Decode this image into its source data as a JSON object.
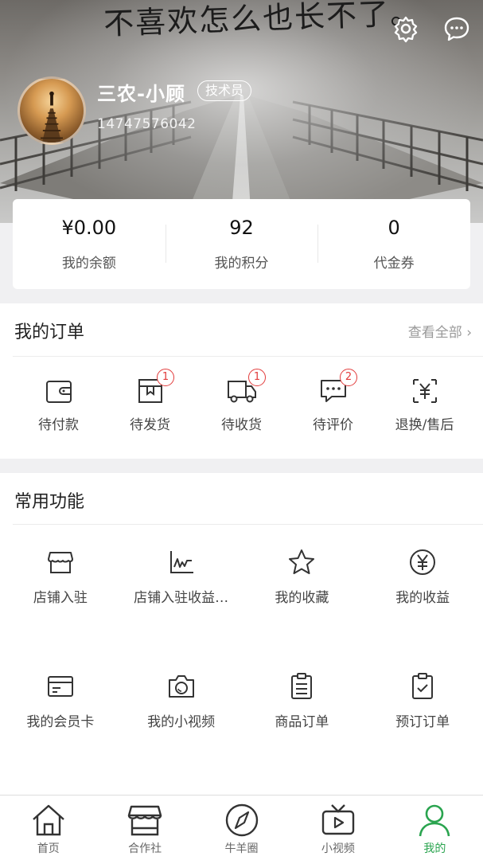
{
  "header": {
    "scribble_text": "不喜欢怎么也长不了。",
    "user_name": "三农-小顾",
    "role_badge": "技术员",
    "phone": "14747576042",
    "settings_icon": "gear-icon",
    "message_icon": "chat-bubble-icon"
  },
  "stats": [
    {
      "value": "¥0.00",
      "label": "我的余额"
    },
    {
      "value": "92",
      "label": "我的积分"
    },
    {
      "value": "0",
      "label": "代金券"
    }
  ],
  "orders": {
    "title": "我的订单",
    "view_all": "查看全部 ›",
    "items": [
      {
        "label": "待付款",
        "icon": "wallet-icon",
        "count": ""
      },
      {
        "label": "待发货",
        "icon": "package-icon",
        "count": "1"
      },
      {
        "label": "待收货",
        "icon": "truck-icon",
        "count": "1"
      },
      {
        "label": "待评价",
        "icon": "comment-icon",
        "count": "2"
      },
      {
        "label": "退换/售后",
        "icon": "refund-icon",
        "count": ""
      }
    ]
  },
  "functions": {
    "title": "常用功能",
    "items": [
      {
        "label": "店铺入驻",
        "icon": "store-icon"
      },
      {
        "label": "店铺入驻收益…",
        "icon": "chart-icon"
      },
      {
        "label": "我的收藏",
        "icon": "star-icon"
      },
      {
        "label": "我的收益",
        "icon": "yen-circle-icon"
      },
      {
        "label": "我的会员卡",
        "icon": "card-icon"
      },
      {
        "label": "我的小视频",
        "icon": "camera-icon"
      },
      {
        "label": "商品订单",
        "icon": "clipboard-icon"
      },
      {
        "label": "预订订单",
        "icon": "clipboard-check-icon"
      }
    ]
  },
  "tabbar": {
    "active_color": "#2aa44f",
    "items": [
      {
        "label": "首页",
        "icon": "home-icon"
      },
      {
        "label": "合作社",
        "icon": "shop-icon"
      },
      {
        "label": "牛羊圈",
        "icon": "compass-icon"
      },
      {
        "label": "小视频",
        "icon": "tv-icon"
      },
      {
        "label": "我的",
        "icon": "user-icon",
        "active": true
      }
    ]
  }
}
